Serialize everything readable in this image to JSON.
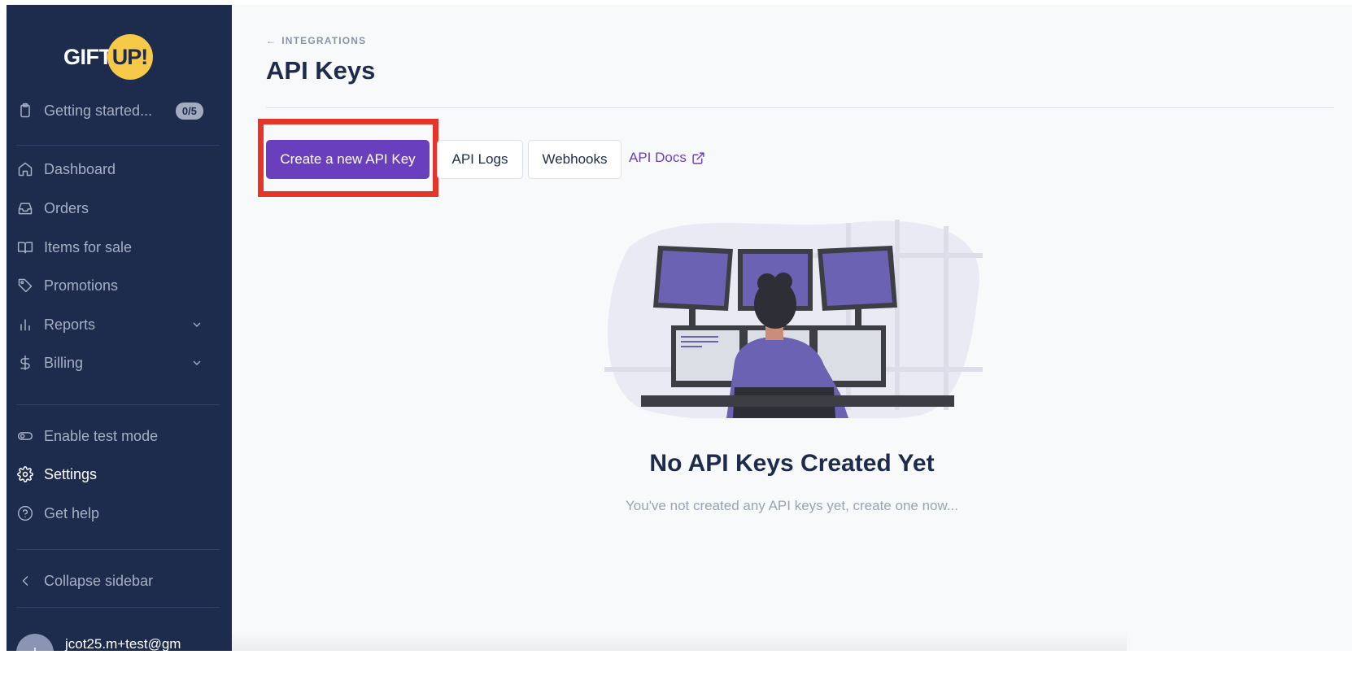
{
  "sidebar": {
    "logo": {
      "text": "GIFT",
      "circle_text": "UP!"
    },
    "getting_started": {
      "label": "Getting started...",
      "badge": "0/5"
    },
    "items": [
      {
        "label": "Dashboard",
        "icon": "home-icon"
      },
      {
        "label": "Orders",
        "icon": "inbox-icon"
      },
      {
        "label": "Items for sale",
        "icon": "book-icon"
      },
      {
        "label": "Promotions",
        "icon": "tag-icon"
      },
      {
        "label": "Reports",
        "icon": "bar-chart-icon"
      },
      {
        "label": "Billing",
        "icon": "dollar-icon"
      }
    ],
    "secondary": [
      {
        "label": "Enable test mode",
        "icon": "toggle-icon"
      },
      {
        "label": "Settings",
        "icon": "gear-icon"
      },
      {
        "label": "Get help",
        "icon": "help-circle-icon"
      }
    ],
    "collapse_label": "Collapse sidebar",
    "user_email": "jcot25.m+test@gm"
  },
  "main": {
    "breadcrumb": "INTEGRATIONS",
    "title": "API Keys",
    "actions": {
      "create": "Create a new API Key",
      "logs": "API Logs",
      "webhooks": "Webhooks",
      "docs": "API Docs"
    },
    "empty": {
      "title": "No API Keys Created Yet",
      "subtitle": "You've not created any API keys yet, create one now..."
    }
  },
  "colors": {
    "sidebar_bg": "#1d2b4c",
    "primary": "#6a3fbd",
    "highlight": "#e5352b",
    "logo_yellow": "#f7c948"
  }
}
